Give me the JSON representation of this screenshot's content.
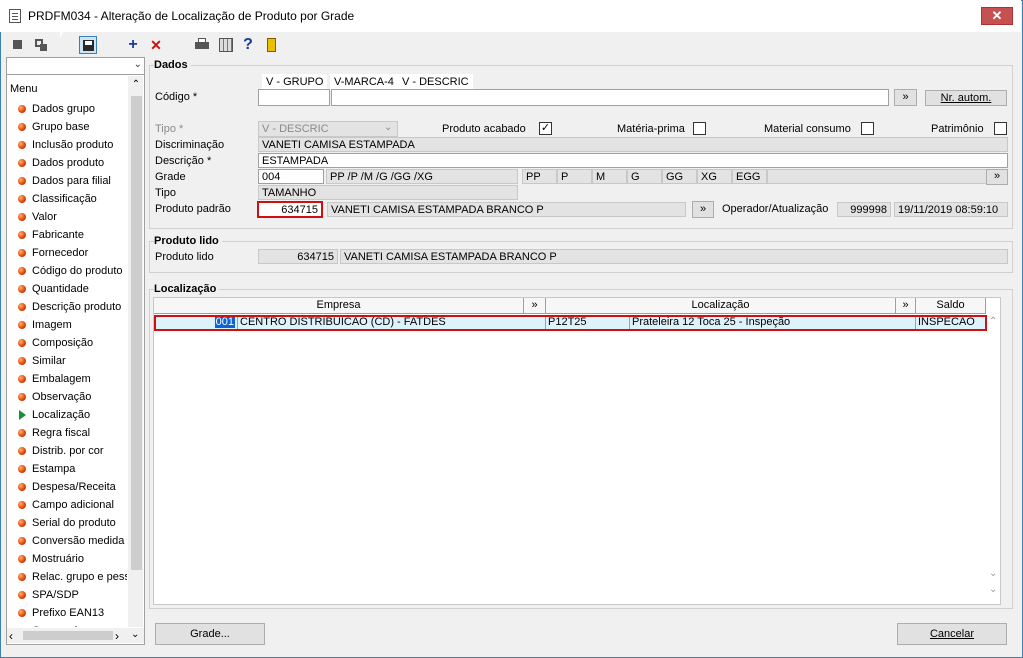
{
  "window": {
    "title": "PRDFM034 - Alteração de Localização de Produto por Grade",
    "close": "✕"
  },
  "toolbar": {
    "add": "+",
    "delete": "✕",
    "help": "?"
  },
  "menu": {
    "header": "Menu",
    "items": [
      "Dados grupo",
      "Grupo base",
      "Inclusão produto",
      "Dados produto",
      "Dados para filial",
      "Classificação",
      "Valor",
      "Fabricante",
      "Fornecedor",
      "Código do produto",
      "Quantidade",
      "Descrição produto",
      "Imagem",
      "Composição",
      "Similar",
      "Embalagem",
      "Observação",
      "Localização",
      "Regra fiscal",
      "Distrib. por cor",
      "Estampa",
      "Despesa/Receita",
      "Campo adicional",
      "Serial do produto",
      "Conversão medida",
      "Mostruário",
      "Relac. grupo e pess",
      "SPA/SDP",
      "Prefixo EAN13",
      "Comprador"
    ],
    "active": "Localização"
  },
  "dados": {
    "title": "Dados",
    "tabs": [
      "V - GRUPO",
      "V-MARCA-4",
      "V - DESCRIC"
    ],
    "codigo_label": "Código *",
    "codigo_value": "",
    "more": "»",
    "nr_autom": "Nr. autom.",
    "tipo_label": "Tipo *",
    "tipo_value": "V - DESCRIC",
    "produto_acabado": "Produto acabado",
    "materia_prima": "Matéria-prima",
    "material_consumo": "Material consumo",
    "patrimonio": "Patrimônio",
    "check": "✓",
    "discriminacao_label": "Discriminação",
    "discriminacao_value": "VANETI CAMISA ESTAMPADA",
    "descricao_label": "Descrição *",
    "descricao_value": "ESTAMPADA",
    "grade_label": "Grade",
    "grade_code": "004",
    "grade_sizes": "PP /P  /M  /G  /GG /XG",
    "sizes": [
      "PP",
      "P",
      "M",
      "G",
      "GG",
      "XG",
      "EGG"
    ],
    "tipo2_label": "Tipo",
    "tipo2_value": "TAMANHO",
    "produto_padrao_label": "Produto padrão",
    "produto_padrao_code": "634715",
    "produto_padrao_desc": "VANETI CAMISA ESTAMPADA BRANCO P",
    "operador_label": "Operador/Atualização",
    "operador": "999998",
    "atualizacao": "19/11/2019 08:59:10"
  },
  "produto_lido": {
    "title": "Produto lido",
    "label": "Produto lido",
    "code": "634715",
    "desc": "VANETI CAMISA ESTAMPADA BRANCO P"
  },
  "localizacao": {
    "title": "Localização",
    "columns": {
      "empresa": "Empresa",
      "localizacao": "Localização",
      "saldo": "Saldo"
    },
    "row": {
      "empresa_code": "001",
      "empresa_name": "CENTRO DISTRIBUICAO (CD) - FATDES",
      "loc_code": "P12T25",
      "loc_desc": "Prateleira 12 Toca 25 - Inspeção",
      "saldo": "INSPECAO"
    }
  },
  "buttons": {
    "grade": "Grade...",
    "cancelar": "Cancelar"
  }
}
